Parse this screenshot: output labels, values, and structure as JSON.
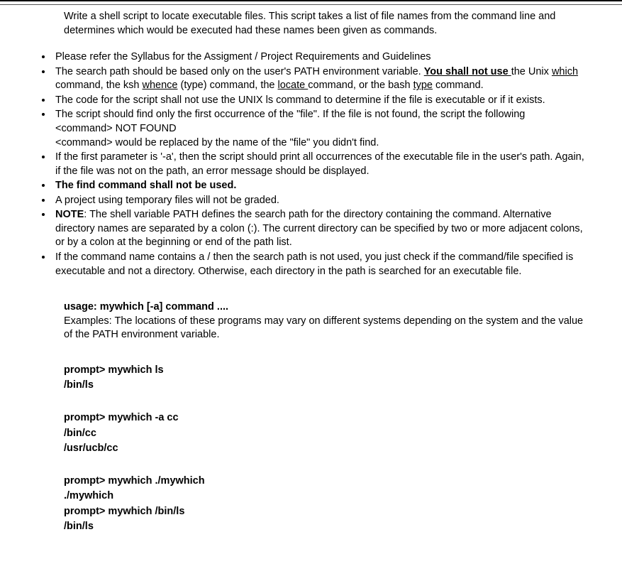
{
  "intro": "Write a shell script to locate executable files. This script takes a list of file names from the command line and determines which would be executed had these names been given as commands.",
  "bullets": {
    "b0": "Please refer the Syllabus for the Assigment / Project Requirements and Guidelines",
    "b1_a": "The search path should be based only on the user's PATH environment variable. ",
    "b1_b": "You shall not use ",
    "b1_c": "the Unix ",
    "b1_d": "which ",
    "b1_e": "command, the ksh ",
    "b1_f": "whence",
    "b1_g": " (type) command, the ",
    "b1_h": "locate ",
    "b1_i": "command, or the bash ",
    "b1_j": "type",
    "b1_k": " command.",
    "b2": "The code for the script shall not use the UNIX ls command to determine if the file is executable or if it exists.",
    "b3_a": "The script should find only the first occurrence of the \"file\". If the file is not found, the script  the following",
    "b3_b": "<command> NOT FOUND",
    "b3_c": "<command> would be replaced by the name of the \"file\" you didn't find.",
    "b4": "If the first parameter is '-a', then the script should print all occurrences of the executable file in the user's path. Again, if the file was not on the path, an error message should be displayed.",
    "b5": "The find command shall not be used.",
    "b6": "A project using temporary files will not be graded.",
    "b7_a": "NOTE",
    "b7_b": ": The shell variable PATH defines the search path for the directory containing the command. Alternative directory names are separated by a colon (:). The current directory can be specified by two or more adjacent colons, or by a colon at the beginning or end of the path list.",
    "b8": "If the command name contains a / then the search path is not used, you just check if the command/file specified is executable and not a directory. Otherwise, each directory in the path is searched for an executable file."
  },
  "usage": {
    "heading": "usage: mywhich [-a] command ....",
    "desc": "Examples: The locations of these programs may vary on different systems depending on the system and the value of the PATH environment variable."
  },
  "examples": {
    "e1_prompt": "prompt> mywhich ls",
    "e1_out1": "/bin/ls",
    "e2_prompt": "prompt> mywhich -a cc",
    "e2_out1": "/bin/cc",
    "e2_out2": "/usr/ucb/cc",
    "e3_prompt": "prompt> mywhich ./mywhich",
    "e3_out1": "./mywhich",
    "e4_prompt": "prompt> mywhich /bin/ls",
    "e4_out1": "/bin/ls"
  }
}
